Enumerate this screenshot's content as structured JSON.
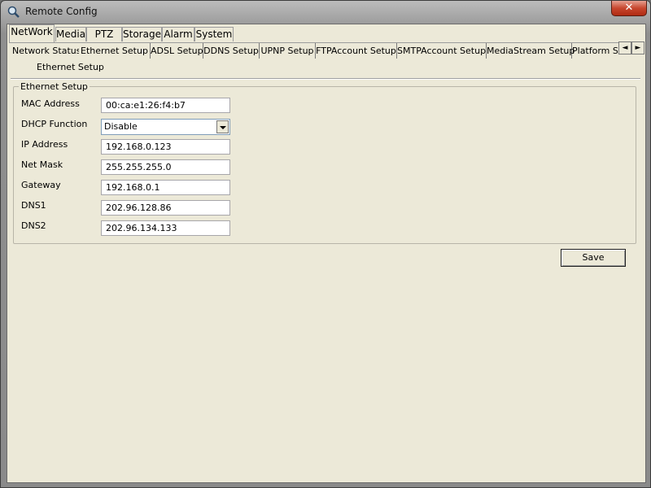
{
  "window": {
    "title": "Remote Config",
    "close_label": "✕"
  },
  "main_tabs": [
    {
      "label": "NetWork"
    },
    {
      "label": "Media"
    },
    {
      "label": "PTZ"
    },
    {
      "label": "Storage"
    },
    {
      "label": "Alarm"
    },
    {
      "label": "System"
    }
  ],
  "sub_tabs": [
    {
      "label": "Network Status"
    },
    {
      "label": "Ethernet Setup"
    },
    {
      "label": "ADSL Setup"
    },
    {
      "label": "DDNS Setup"
    },
    {
      "label": "UPNP Setup"
    },
    {
      "label": "FTPAccount Setup"
    },
    {
      "label": "SMTPAccount Setup"
    },
    {
      "label": "MediaStream Setup"
    },
    {
      "label": "Platform Se"
    }
  ],
  "scroll": {
    "left": "◄",
    "right": "►"
  },
  "page": {
    "subtitle": "Ethernet Setup",
    "group_title": "Ethernet Setup"
  },
  "form": {
    "mac_label": "MAC Address",
    "mac_value": "00:ca:e1:26:f4:b7",
    "dhcp_label": "DHCP Function",
    "dhcp_value": "Disable",
    "ip_label": "IP Address",
    "ip_value": "192.168.0.123",
    "mask_label": "Net Mask",
    "mask_value": "255.255.255.0",
    "gateway_label": "Gateway",
    "gateway_value": "192.168.0.1",
    "dns1_label": "DNS1",
    "dns1_value": "202.96.128.86",
    "dns2_label": "DNS2",
    "dns2_value": "202.96.134.133"
  },
  "actions": {
    "save_label": "Save"
  }
}
